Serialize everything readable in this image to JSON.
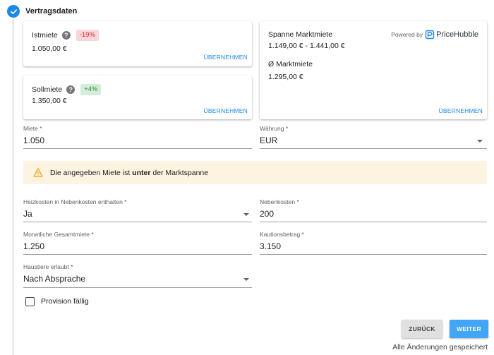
{
  "step": {
    "title": "Vertragsdaten"
  },
  "cards": {
    "istmiete": {
      "label": "Istmiete",
      "badge": "-19%",
      "value": "1.050,00 €",
      "action": "ÜBERNEHMEN"
    },
    "sollmiete": {
      "label": "Sollmiete",
      "badge": "+4%",
      "value": "1.350,00 €",
      "action": "ÜBERNEHMEN"
    },
    "market": {
      "range_label": "Spanne Marktmiete",
      "range_value": "1.149,00 € - 1.441,00 €",
      "avg_label": "Ø Marktmiete",
      "avg_value": "1.295,00 €",
      "powered_by": "Powered by",
      "provider": "PriceHubble",
      "action": "ÜBERNEHMEN"
    }
  },
  "fields": {
    "miete": {
      "label": "Miete *",
      "value": "1.050"
    },
    "waehrung": {
      "label": "Währung *",
      "value": "EUR"
    },
    "heizkosten": {
      "label": "Heizkosten in Nebenkosten enthalten *",
      "value": "Ja"
    },
    "nebenkosten": {
      "label": "Nebenkosten *",
      "value": "200"
    },
    "gesamtmiete": {
      "label": "Monatliche Gesamtmiete *",
      "value": "1.250"
    },
    "kaution": {
      "label": "Kautionsbetrag *",
      "value": "3.150"
    },
    "haustiere": {
      "label": "Haustiere erlaubt *",
      "value": "Nach Absprache"
    }
  },
  "warning": {
    "text_before": "Die angegeben Miete ist ",
    "text_bold": "unter",
    "text_after": " der Marktspanne"
  },
  "provision": {
    "label": "Provision fällig",
    "checked": false
  },
  "buttons": {
    "back": "ZURÜCK",
    "next": "WEITER"
  },
  "status": "Alle Änderungen gespeichert",
  "colors": {
    "accent": "#1e88e5",
    "warning_bg": "#fdf3e1",
    "warning_icon": "#f9a825",
    "badge_negative": "#d32f2f",
    "badge_positive": "#388e3c"
  }
}
